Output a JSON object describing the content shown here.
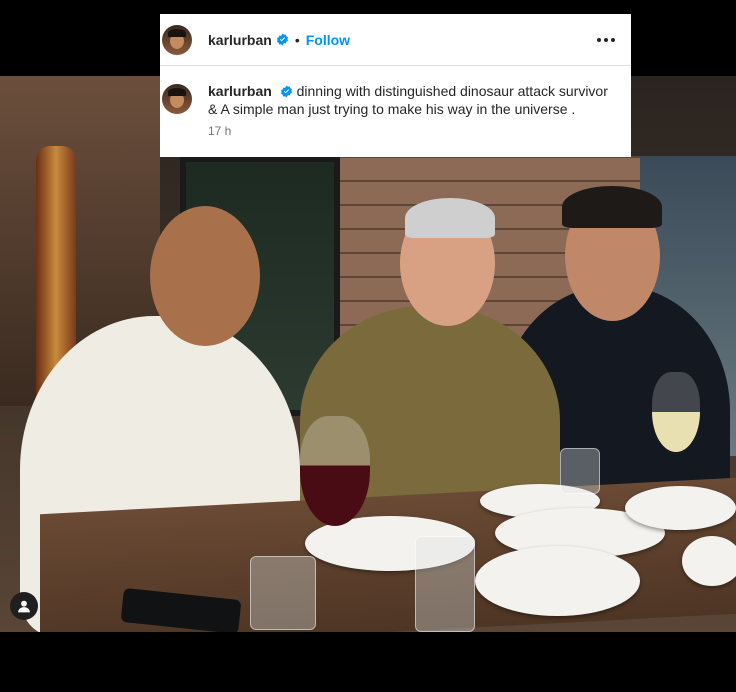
{
  "post": {
    "username": "karlurban",
    "follow_label": "Follow",
    "separator": "•",
    "caption_text": "dinning with distinguished dinosaur attack survivor & A simple man just trying to make his way in the universe .",
    "timestamp": "17 h"
  },
  "colors": {
    "follow": "#0095f6",
    "verified": "#0095f6",
    "text": "#262626",
    "muted": "#737373"
  },
  "icons": {
    "verified": "verified-badge-icon",
    "more": "more-options-icon",
    "user": "user-tag-icon"
  }
}
